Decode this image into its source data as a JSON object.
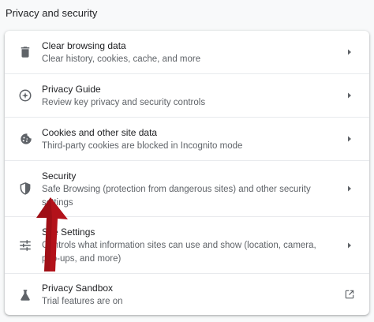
{
  "section_title": "Privacy and security",
  "colors": {
    "icon": "#5f6368",
    "arrow": "#b3121a",
    "title": "#202124",
    "desc": "#5f6368"
  },
  "items": [
    {
      "title": "Clear browsing data",
      "desc": "Clear history, cookies, cache, and more",
      "icon": "trash-icon",
      "action": "chevron-right-icon"
    },
    {
      "title": "Privacy Guide",
      "desc": "Review key privacy and security controls",
      "icon": "compass-icon",
      "action": "chevron-right-icon"
    },
    {
      "title": "Cookies and other site data",
      "desc": "Third-party cookies are blocked in Incognito mode",
      "icon": "cookie-icon",
      "action": "chevron-right-icon"
    },
    {
      "title": "Security",
      "desc": "Safe Browsing (protection from dangerous sites) and other security settings",
      "icon": "shield-icon",
      "action": "chevron-right-icon"
    },
    {
      "title": "Site Settings",
      "desc": "Controls what information sites can use and show (location, camera, pop-ups, and more)",
      "icon": "sliders-icon",
      "action": "chevron-right-icon"
    },
    {
      "title": "Privacy Sandbox",
      "desc": "Trial features are on",
      "icon": "flask-icon",
      "action": "open-in-new-icon"
    }
  ]
}
